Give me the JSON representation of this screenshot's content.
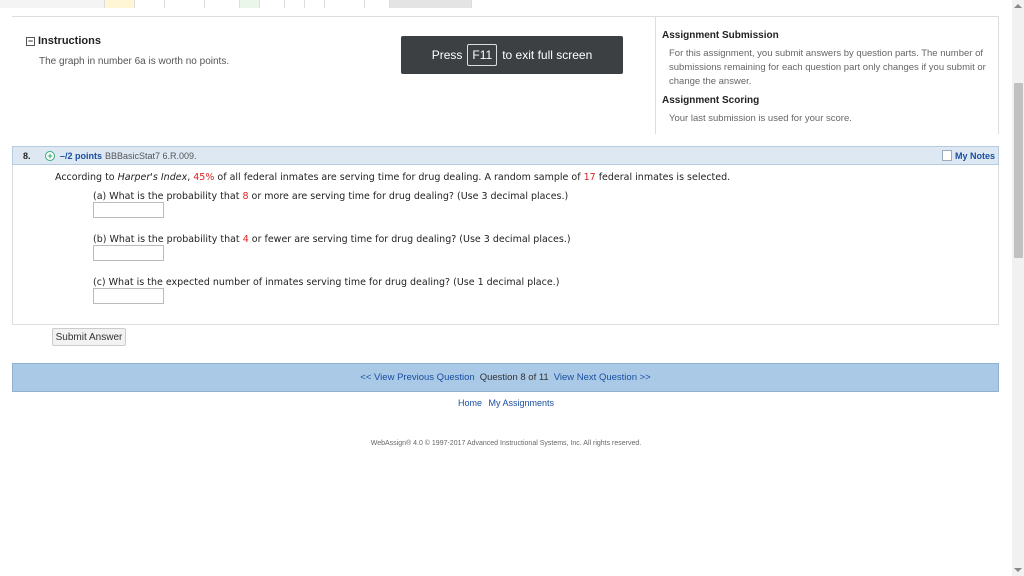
{
  "instructions": {
    "title": "Instructions",
    "toggle": "−",
    "text": "The graph in number 6a is worth no points."
  },
  "fullscreen": {
    "press": "Press",
    "key": "F11",
    "suffix": "to exit full screen"
  },
  "assignment": {
    "submission_title": "Assignment Submission",
    "submission_text_1": "For this assignment, you submit answers by question parts. The number of",
    "submission_text_2": "submissions remaining for each question part only changes if you submit or",
    "submission_text_3": "change the answer.",
    "scoring_title": "Assignment Scoring",
    "scoring_text": "Your last submission is used for your score."
  },
  "question": {
    "number": "8.",
    "plus": "+",
    "points": "–/2 points",
    "code": "BBBasicStat7 6.R.009.",
    "my_notes": "My Notes",
    "stem_pre": "According to ",
    "stem_italic": "Harper's Index",
    "stem_mid1": ", ",
    "stem_pct": "45%",
    "stem_mid2": " of all federal inmates are serving time for drug dealing. A random sample of ",
    "stem_n": "17",
    "stem_post": " federal inmates is selected.",
    "part_a_pre": "(a) What is the probability that ",
    "part_a_num": "8",
    "part_a_post": " or more are serving time for drug dealing? (Use 3 decimal places.)",
    "part_b_pre": "(b) What is the probability that ",
    "part_b_num": "4",
    "part_b_post": " or fewer are serving time for drug dealing? (Use 3 decimal places.)",
    "part_c": "(c) What is the expected number of inmates serving time for drug dealing? (Use 1 decimal place.)",
    "answer_a": "",
    "answer_b": "",
    "answer_c": ""
  },
  "submit_label": "Submit Answer",
  "nav": {
    "prev": "<< View Previous Question",
    "status": "Question 8 of 11",
    "next": "View Next Question >>"
  },
  "footer": {
    "home": "Home",
    "my_assignments": "My Assignments",
    "copyright": "WebAssign® 4.0 © 1997-2017 Advanced Instructional Systems, Inc. All rights reserved."
  },
  "colors": {
    "accent_red": "#d22222",
    "link_blue": "#1a4ea0",
    "nav_bar": "#a9c9e6",
    "question_bar": "#dde8f3"
  }
}
